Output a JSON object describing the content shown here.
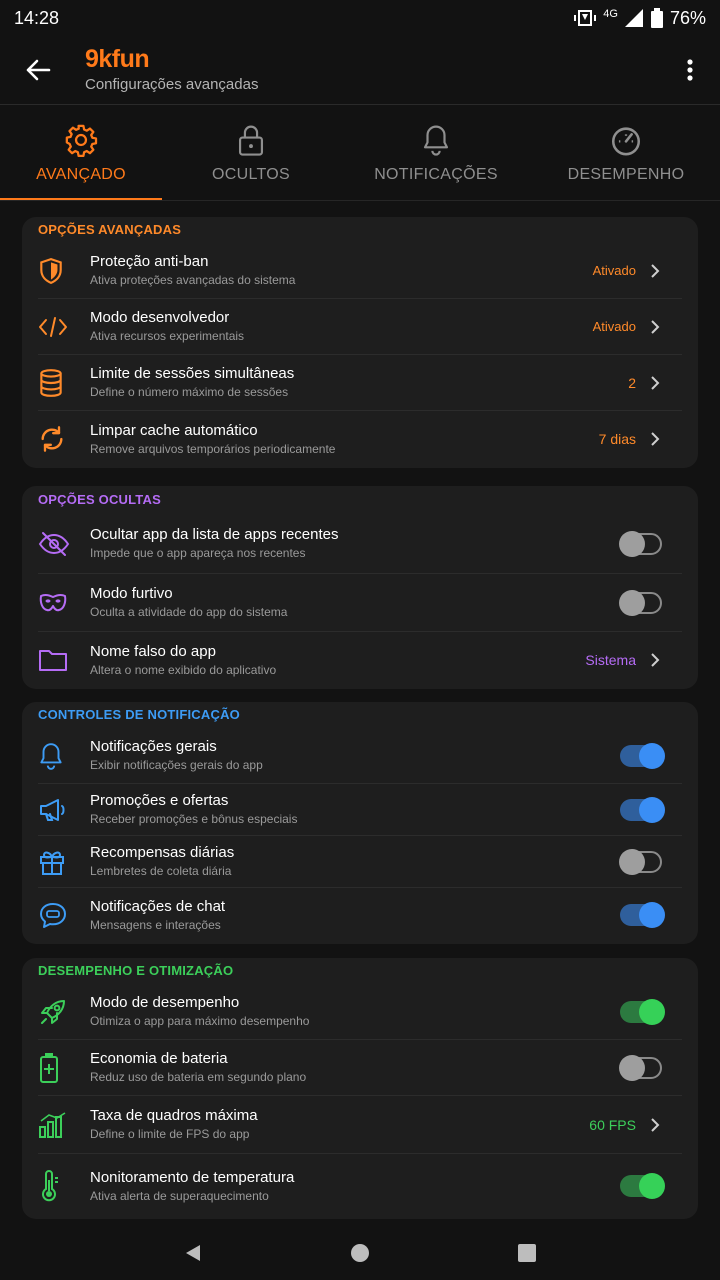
{
  "status_bar": {
    "time": "14:28",
    "network": "4G",
    "battery": "76%"
  },
  "header": {
    "title": "9kfun",
    "subtitle": "Configurações avançadas"
  },
  "tabs": [
    {
      "label": "AVANÇADO",
      "icon": "gear-icon",
      "active": true
    },
    {
      "label": "OCULTOS",
      "icon": "lock-icon",
      "active": false
    },
    {
      "label": "NOTIFICAÇÕES",
      "icon": "bell-icon",
      "active": false
    },
    {
      "label": "DESEMPENHO",
      "icon": "speedometer-icon",
      "active": false
    }
  ],
  "sections": {
    "advanced": {
      "title": "OPÇÕES AVANÇADAS",
      "color": "#ff8a2a",
      "items": [
        {
          "title": "Proteção anti-ban",
          "desc": "Ativa proteções avançadas do sistema",
          "value": "Ativado",
          "icon": "shield-icon"
        },
        {
          "title": "Modo desenvolvedor",
          "desc": "Ativa recursos experimentais",
          "value": "Ativado",
          "icon": "code-icon"
        },
        {
          "title": "Limite de sessões simultâneas",
          "desc": "Define o número máximo de sessões",
          "value": "2",
          "icon": "database-icon"
        },
        {
          "title": "Limpar cache automático",
          "desc": "Remove arquivos temporários periodicamente",
          "value": "7 dias",
          "icon": "refresh-icon"
        }
      ]
    },
    "hidden": {
      "title": "OPÇÕES OCULTAS",
      "color": "#b56cf5",
      "items": [
        {
          "title": "Ocultar app da lista de apps recentes",
          "desc": "Impede que o app apareça nos recentes",
          "toggle": false,
          "icon": "eye-off-icon"
        },
        {
          "title": "Modo furtivo",
          "desc": "Oculta a atividade do app do sistema",
          "toggle": false,
          "icon": "mask-icon"
        },
        {
          "title": "Nome falso do app",
          "desc": "Altera o nome exibido do aplicativo",
          "value": "Sistema",
          "icon": "folder-icon"
        }
      ]
    },
    "notifications": {
      "title": "CONTROLES DE NOTIFICAÇÃO",
      "color": "#3d9cf5",
      "items": [
        {
          "title": "Notificações gerais",
          "desc": "Exibir notificações gerais do app",
          "toggle": true,
          "icon": "bell-icon"
        },
        {
          "title": "Promoções e ofertas",
          "desc": "Receber promoções e bônus especiais",
          "toggle": true,
          "icon": "megaphone-icon"
        },
        {
          "title": "Recompensas diárias",
          "desc": "Lembretes de coleta diária",
          "toggle": false,
          "icon": "gift-icon"
        },
        {
          "title": "Notificações de chat",
          "desc": "Mensagens e interações",
          "toggle": true,
          "icon": "chat-icon"
        }
      ]
    },
    "performance": {
      "title": "DESEMPENHO E OTIMIZAÇÃO",
      "color": "#3ccf5a",
      "items": [
        {
          "title": "Modo de desempenho",
          "desc": "Otimiza o app para máximo desempenho",
          "toggle": true,
          "icon": "rocket-icon"
        },
        {
          "title": "Economia de bateria",
          "desc": "Reduz uso de bateria em segundo plano",
          "toggle": false,
          "icon": "battery-icon"
        },
        {
          "title": "Taxa de quadros máxima",
          "desc": "Define o limite de FPS do app",
          "value": "60 FPS",
          "icon": "bars-icon"
        },
        {
          "title": "Nonitoramento de temperatura",
          "desc": "Ativa alerta de superaquecimento",
          "toggle": true,
          "icon": "thermometer-icon"
        }
      ]
    }
  },
  "colors": {
    "accent": "#ff7a1a",
    "toggle_on_blue": "#3a8ef5",
    "toggle_on_green": "#36d158"
  }
}
